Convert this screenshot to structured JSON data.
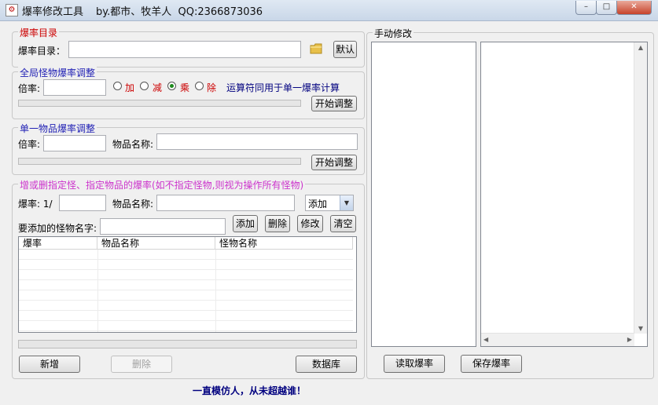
{
  "window": {
    "title": "爆率修改工具",
    "author": "by.都市、牧羊人  QQ:2366873036",
    "buttons": {
      "minimize": "–",
      "maximize": "□",
      "close": "✕"
    }
  },
  "dir_group": {
    "legend": "爆率目录",
    "label": "爆率目录：",
    "value": "",
    "default_button": "默认",
    "legend_color": "#cc0000"
  },
  "global_group": {
    "legend": "全局怪物爆率调整",
    "rate_label": "倍率:",
    "rate_value": "",
    "ops": [
      "加",
      "减",
      "乘",
      "除"
    ],
    "selected_op": 2,
    "hint": "运算符同用于单一爆率计算",
    "start_button": "开始调整",
    "legend_color": "#1f1fb4"
  },
  "single_group": {
    "legend": "单一物品爆率调整",
    "rate_label": "倍率:",
    "item_label": "物品名称:",
    "start_button": "开始调整",
    "legend_color": "#1f1fb4"
  },
  "specify_group": {
    "legend": "增或删指定怪、指定物品的爆率(如不指定怪物,则视为操作所有怪物)",
    "rate_label": "爆率: 1/",
    "item_label": "物品名称:",
    "action_select": "添加",
    "monster_label": "要添加的怪物名字:",
    "buttons": {
      "add": "添加",
      "delete": "删除",
      "modify": "修改",
      "clear": "清空"
    },
    "columns": [
      "爆率",
      "物品名称",
      "怪物名称"
    ],
    "legend_color": "#cc33cc"
  },
  "bottom_buttons": {
    "new": "新增",
    "remove": "删除",
    "database": "数据库"
  },
  "manual_group": {
    "legend": "手动修改",
    "read_button": "读取爆率",
    "save_button": "保存爆率"
  },
  "footer": {
    "slogan": "一直模仿人，从未超越谁！",
    "color": "#00007f"
  }
}
